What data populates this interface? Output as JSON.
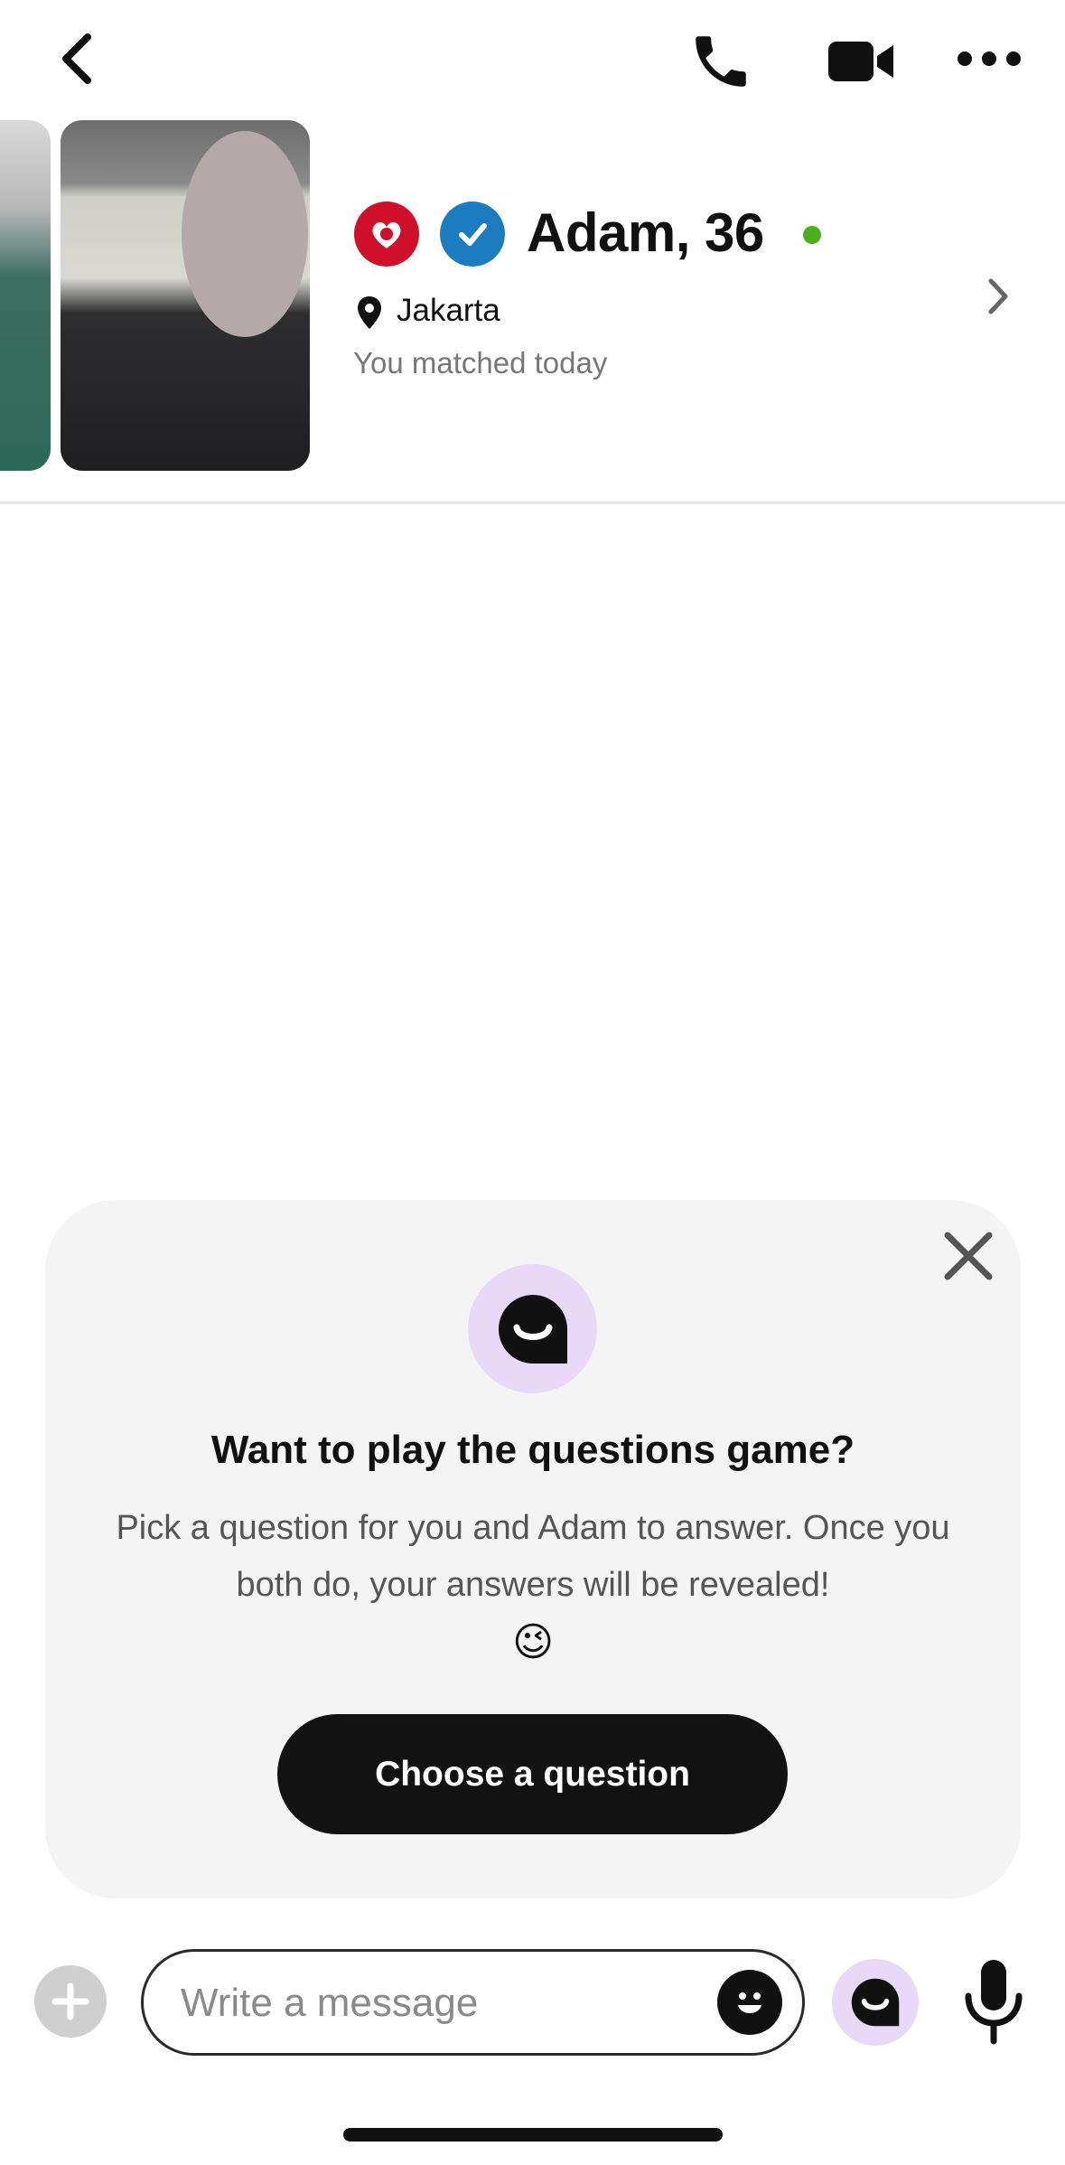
{
  "header": {
    "back_icon": "chevron-left-icon",
    "call_icon": "phone-icon",
    "video_icon": "video-camera-icon",
    "more_icon": "more-horizontal-icon"
  },
  "profile": {
    "name": "Adam, 36",
    "location": "Jakarta",
    "matched_text": "You matched today",
    "online_color": "#4cae1f",
    "match_badge_color": "#d0102a",
    "verified_badge_color": "#1c7cc0"
  },
  "questions_card": {
    "title": "Want to play the questions game?",
    "body": "Pick a question for you and Adam to answer. Once you both do, your answers will be revealed!",
    "emoji": "😉",
    "button_label": "Choose a question",
    "icon_bg": "#e9d9f8"
  },
  "composer": {
    "placeholder": "Write a message"
  }
}
